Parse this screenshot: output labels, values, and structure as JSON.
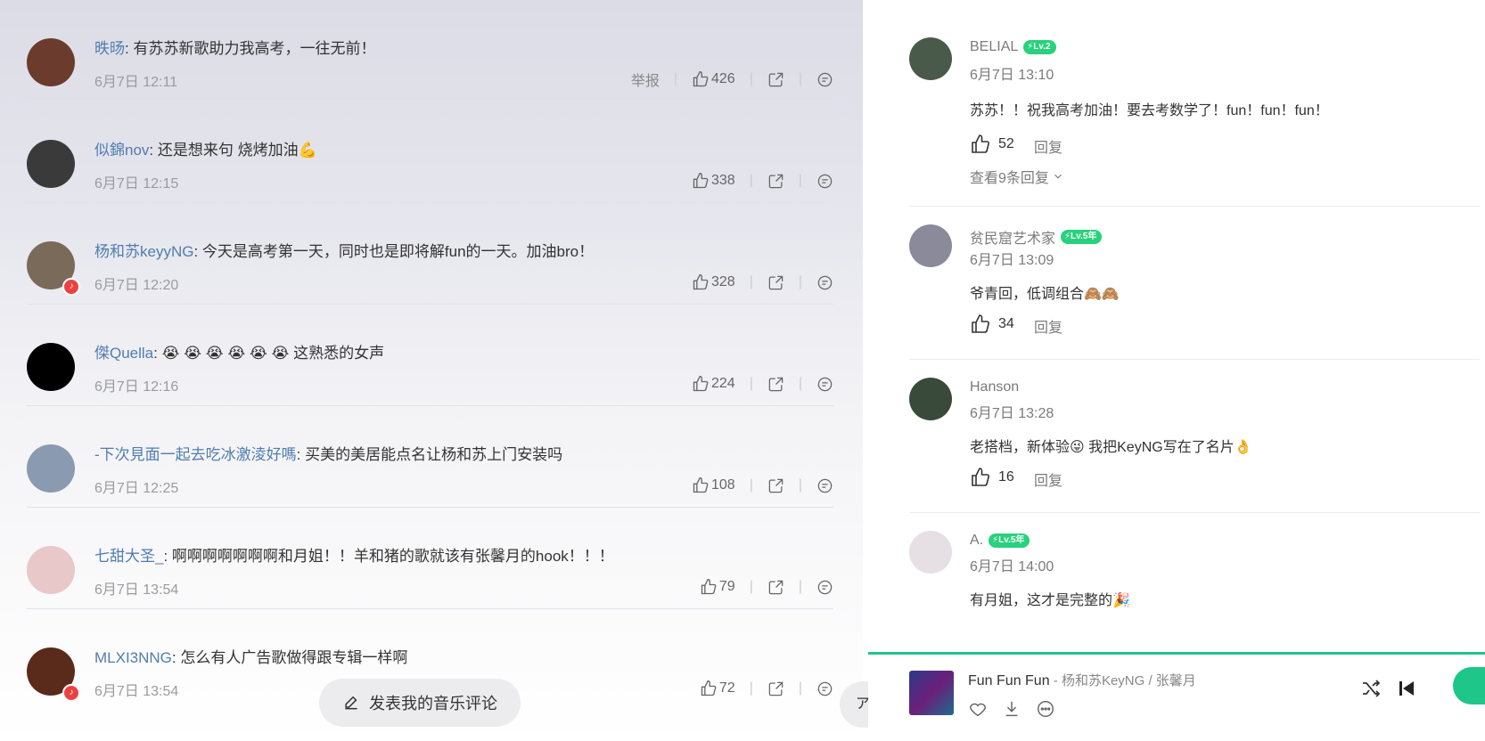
{
  "left_comments": [
    {
      "user": "昳旸",
      "text": ": 有苏苏新歌助力我高考，一往无前！",
      "time": "6月7日 12:11",
      "report": "举报",
      "likes": "426",
      "badge": false,
      "avatar_color": "#6b3b2e"
    },
    {
      "user": "似錦nov",
      "text": ": 还是想来句 烧烤加油💪",
      "time": "6月7日 12:15",
      "report": "",
      "likes": "338",
      "badge": false,
      "avatar_color": "#3a3a3a"
    },
    {
      "user": "杨和苏keyyNG",
      "text": ": 今天是高考第一天，同时也是即将解fun的一天。加油bro！",
      "time": "6月7日 12:20",
      "report": "",
      "likes": "328",
      "badge": true,
      "avatar_color": "#7a6a5a"
    },
    {
      "user": "傑Quella",
      "text": ": 😭 😭 😭 😭 😭 😭 这熟悉的女声",
      "time": "6月7日 12:16",
      "report": "",
      "likes": "224",
      "badge": false,
      "avatar_color": "#000000"
    },
    {
      "user": "-下次見面一起去吃冰激淩好嗎",
      "text": ": 买美的美居能点名让杨和苏上门安装吗",
      "time": "6月7日 12:25",
      "report": "",
      "likes": "108",
      "badge": false,
      "avatar_color": "#8a9ab0"
    },
    {
      "user": "七甜大圣_",
      "text": ": 啊啊啊啊啊啊啊和月姐！！羊和猪的歌就该有张馨月的hook！！！",
      "time": "6月7日 13:54",
      "report": "",
      "likes": "79",
      "badge": false,
      "avatar_color": "#e8c8c8"
    },
    {
      "user": "MLXI3NNG",
      "text": ": 怎么有人广告歌做得跟专辑一样啊",
      "time": "6月7日 13:54",
      "report": "",
      "likes": "72",
      "badge": true,
      "avatar_color": "#5a2a1a"
    }
  ],
  "post_button_label": "发表我的音乐评论",
  "edge_button_label": "ア",
  "right_comments": [
    {
      "name": "BELIAL",
      "level": "Lv.2",
      "time": "6月7日 13:10",
      "text": "苏苏！！祝我高考加油！要去考数学了！fun！fun！fun！",
      "likes": "52",
      "reply": "回复",
      "more": "查看9条回复",
      "avatar_color": "#4a5a4a"
    },
    {
      "name": "贫民窟艺术家",
      "level": "Lv.5年",
      "time": "6月7日 13:09",
      "text": "爷青回，低调组合🙈🙈",
      "likes": "34",
      "reply": "回复",
      "more": "",
      "avatar_color": "#8a8a9a"
    },
    {
      "name": "Hanson",
      "level": "",
      "time": "6月7日 13:28",
      "text": "老搭档，新体验😜 我把KeyNG写在了名片👌",
      "likes": "16",
      "reply": "回复",
      "more": "",
      "avatar_color": "#3a4a3a"
    },
    {
      "name": "A.",
      "level": "Lv.5年",
      "time": "6月7日 14:00",
      "text": "有月姐，这才是完整的🎉",
      "likes": "",
      "reply": "",
      "more": "",
      "avatar_color": "#e6e0e4"
    }
  ],
  "player": {
    "title": "Fun Fun Fun",
    "artist": " - 杨和苏KeyNG / 张馨月"
  },
  "colors": {
    "accent": "#1ec689",
    "link": "#507daf",
    "badge": "#ec4141"
  }
}
